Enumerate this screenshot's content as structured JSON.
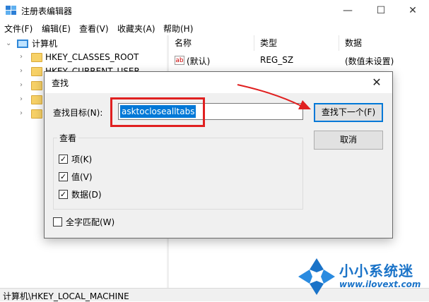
{
  "window": {
    "title": "注册表编辑器",
    "controls": {
      "minimize": "—",
      "maximize": "☐",
      "close": "✕"
    }
  },
  "menu": [
    "文件(F)",
    "编辑(E)",
    "查看(V)",
    "收藏夹(A)",
    "帮助(H)"
  ],
  "tree": {
    "root": "计算机",
    "items": [
      "HKEY_CLASSES_ROOT",
      "HKEY_CURRENT_USER"
    ]
  },
  "list": {
    "columns": [
      "名称",
      "类型",
      "数据"
    ],
    "rows": [
      {
        "name": "(默认)",
        "type": "REG_SZ",
        "data": "(数值未设置)",
        "icon": "ab"
      }
    ]
  },
  "status": "计算机\\HKEY_LOCAL_MACHINE",
  "dialog": {
    "title": "查找",
    "close": "✕",
    "find_label": "查找目标(N):",
    "find_value": "asktoclosealltabs",
    "find_next": "查找下一个(F)",
    "cancel": "取消",
    "group_title": "查看",
    "options": [
      {
        "label": "项(K)",
        "checked": true
      },
      {
        "label": "值(V)",
        "checked": true
      },
      {
        "label": "数据(D)",
        "checked": true
      }
    ],
    "match_whole": {
      "label": "全字匹配(W)",
      "checked": false
    }
  },
  "watermark": {
    "title": "小小系统迷",
    "url": "www.ilovext.com"
  },
  "colors": {
    "accent": "#0078d7",
    "highlight_box": "#e02020",
    "watermark": "#1a73c8"
  }
}
